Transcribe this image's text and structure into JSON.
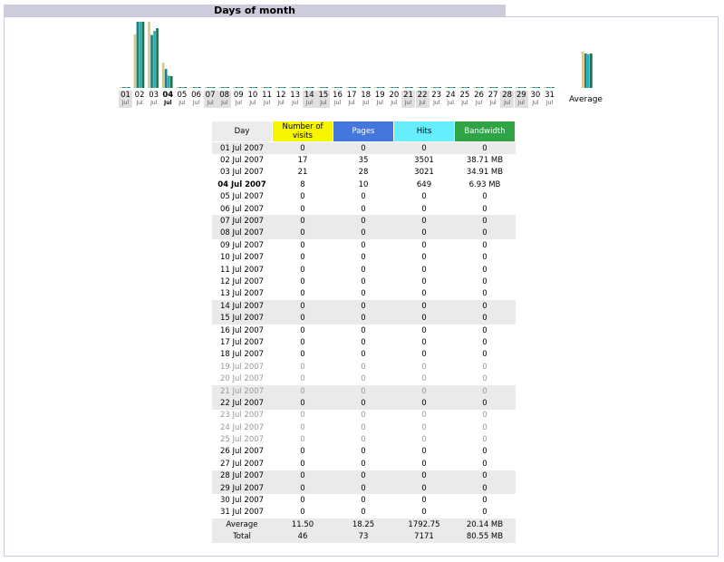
{
  "title": "Days of month",
  "chart_data": {
    "type": "bar",
    "title": "",
    "categories": [
      "01",
      "02",
      "03",
      "04",
      "05",
      "06",
      "07",
      "08",
      "09",
      "10",
      "11",
      "12",
      "13",
      "14",
      "15",
      "16",
      "17",
      "18",
      "19",
      "20",
      "21",
      "22",
      "23",
      "24",
      "25",
      "26",
      "27",
      "28",
      "29",
      "30",
      "31"
    ],
    "category_month": "Jul",
    "series": [
      {
        "name": "Number of visits",
        "color": "#d8c88a",
        "values": [
          0,
          17,
          21,
          8,
          0,
          0,
          0,
          0,
          0,
          0,
          0,
          0,
          0,
          0,
          0,
          0,
          0,
          0,
          0,
          0,
          0,
          0,
          0,
          0,
          0,
          0,
          0,
          0,
          0,
          0,
          0
        ]
      },
      {
        "name": "Pages",
        "color": "#1f7f7f",
        "values": [
          0,
          35,
          28,
          10,
          0,
          0,
          0,
          0,
          0,
          0,
          0,
          0,
          0,
          0,
          0,
          0,
          0,
          0,
          0,
          0,
          0,
          0,
          0,
          0,
          0,
          0,
          0,
          0,
          0,
          0,
          0
        ]
      },
      {
        "name": "Hits",
        "color": "#22b0b0",
        "values": [
          0,
          3501,
          3021,
          649,
          0,
          0,
          0,
          0,
          0,
          0,
          0,
          0,
          0,
          0,
          0,
          0,
          0,
          0,
          0,
          0,
          0,
          0,
          0,
          0,
          0,
          0,
          0,
          0,
          0,
          0,
          0
        ]
      },
      {
        "name": "Bandwidth",
        "color": "#1f6f4f",
        "values": [
          0,
          38.71,
          34.91,
          6.93,
          0,
          0,
          0,
          0,
          0,
          0,
          0,
          0,
          0,
          0,
          0,
          0,
          0,
          0,
          0,
          0,
          0,
          0,
          0,
          0,
          0,
          0,
          0,
          0,
          0,
          0,
          0
        ]
      }
    ],
    "weekend_days": [
      "01",
      "07",
      "08",
      "14",
      "15",
      "21",
      "22",
      "28",
      "29"
    ],
    "current_day": "04",
    "average_label": "Average",
    "average": {
      "visits": 11.5,
      "pages": 18.25,
      "hits": 1792.75,
      "bandwidth": 20.14
    }
  },
  "table": {
    "headers": {
      "day": "Day",
      "visits": "Number of visits",
      "pages": "Pages",
      "hits": "Hits",
      "bandwidth": "Bandwidth"
    },
    "rows": [
      {
        "day": "01 Jul 2007",
        "visits": "0",
        "pages": "0",
        "hits": "0",
        "bandwidth": "0",
        "weekend": true
      },
      {
        "day": "02 Jul 2007",
        "visits": "17",
        "pages": "35",
        "hits": "3501",
        "bandwidth": "38.71 MB"
      },
      {
        "day": "03 Jul 2007",
        "visits": "21",
        "pages": "28",
        "hits": "3021",
        "bandwidth": "34.91 MB"
      },
      {
        "day": "04 Jul 2007",
        "visits": "8",
        "pages": "10",
        "hits": "649",
        "bandwidth": "6.93 MB",
        "current": true
      },
      {
        "day": "05 Jul 2007",
        "visits": "0",
        "pages": "0",
        "hits": "0",
        "bandwidth": "0"
      },
      {
        "day": "06 Jul 2007",
        "visits": "0",
        "pages": "0",
        "hits": "0",
        "bandwidth": "0"
      },
      {
        "day": "07 Jul 2007",
        "visits": "0",
        "pages": "0",
        "hits": "0",
        "bandwidth": "0",
        "weekend": true
      },
      {
        "day": "08 Jul 2007",
        "visits": "0",
        "pages": "0",
        "hits": "0",
        "bandwidth": "0",
        "weekend": true
      },
      {
        "day": "09 Jul 2007",
        "visits": "0",
        "pages": "0",
        "hits": "0",
        "bandwidth": "0"
      },
      {
        "day": "10 Jul 2007",
        "visits": "0",
        "pages": "0",
        "hits": "0",
        "bandwidth": "0"
      },
      {
        "day": "11 Jul 2007",
        "visits": "0",
        "pages": "0",
        "hits": "0",
        "bandwidth": "0"
      },
      {
        "day": "12 Jul 2007",
        "visits": "0",
        "pages": "0",
        "hits": "0",
        "bandwidth": "0"
      },
      {
        "day": "13 Jul 2007",
        "visits": "0",
        "pages": "0",
        "hits": "0",
        "bandwidth": "0"
      },
      {
        "day": "14 Jul 2007",
        "visits": "0",
        "pages": "0",
        "hits": "0",
        "bandwidth": "0",
        "weekend": true
      },
      {
        "day": "15 Jul 2007",
        "visits": "0",
        "pages": "0",
        "hits": "0",
        "bandwidth": "0",
        "weekend": true
      },
      {
        "day": "16 Jul 2007",
        "visits": "0",
        "pages": "0",
        "hits": "0",
        "bandwidth": "0"
      },
      {
        "day": "17 Jul 2007",
        "visits": "0",
        "pages": "0",
        "hits": "0",
        "bandwidth": "0"
      },
      {
        "day": "18 Jul 2007",
        "visits": "0",
        "pages": "0",
        "hits": "0",
        "bandwidth": "0"
      },
      {
        "day": "19 Jul 2007",
        "visits": "0",
        "pages": "0",
        "hits": "0",
        "bandwidth": "0",
        "future": true
      },
      {
        "day": "20 Jul 2007",
        "visits": "0",
        "pages": "0",
        "hits": "0",
        "bandwidth": "0",
        "future": true
      },
      {
        "day": "21 Jul 2007",
        "visits": "0",
        "pages": "0",
        "hits": "0",
        "bandwidth": "0",
        "weekend": true,
        "future": true
      },
      {
        "day": "22 Jul 2007",
        "visits": "0",
        "pages": "0",
        "hits": "0",
        "bandwidth": "0",
        "weekend": true
      },
      {
        "day": "23 Jul 2007",
        "visits": "0",
        "pages": "0",
        "hits": "0",
        "bandwidth": "0",
        "future": true
      },
      {
        "day": "24 Jul 2007",
        "visits": "0",
        "pages": "0",
        "hits": "0",
        "bandwidth": "0",
        "future": true
      },
      {
        "day": "25 Jul 2007",
        "visits": "0",
        "pages": "0",
        "hits": "0",
        "bandwidth": "0",
        "future": true
      },
      {
        "day": "26 Jul 2007",
        "visits": "0",
        "pages": "0",
        "hits": "0",
        "bandwidth": "0"
      },
      {
        "day": "27 Jul 2007",
        "visits": "0",
        "pages": "0",
        "hits": "0",
        "bandwidth": "0"
      },
      {
        "day": "28 Jul 2007",
        "visits": "0",
        "pages": "0",
        "hits": "0",
        "bandwidth": "0",
        "weekend": true
      },
      {
        "day": "29 Jul 2007",
        "visits": "0",
        "pages": "0",
        "hits": "0",
        "bandwidth": "0",
        "weekend": true
      },
      {
        "day": "30 Jul 2007",
        "visits": "0",
        "pages": "0",
        "hits": "0",
        "bandwidth": "0"
      },
      {
        "day": "31 Jul 2007",
        "visits": "0",
        "pages": "0",
        "hits": "0",
        "bandwidth": "0"
      }
    ],
    "summary": [
      {
        "label": "Average",
        "visits": "11.50",
        "pages": "18.25",
        "hits": "1792.75",
        "bandwidth": "20.14 MB"
      },
      {
        "label": "Total",
        "visits": "46",
        "pages": "73",
        "hits": "7171",
        "bandwidth": "80.55 MB"
      }
    ]
  }
}
